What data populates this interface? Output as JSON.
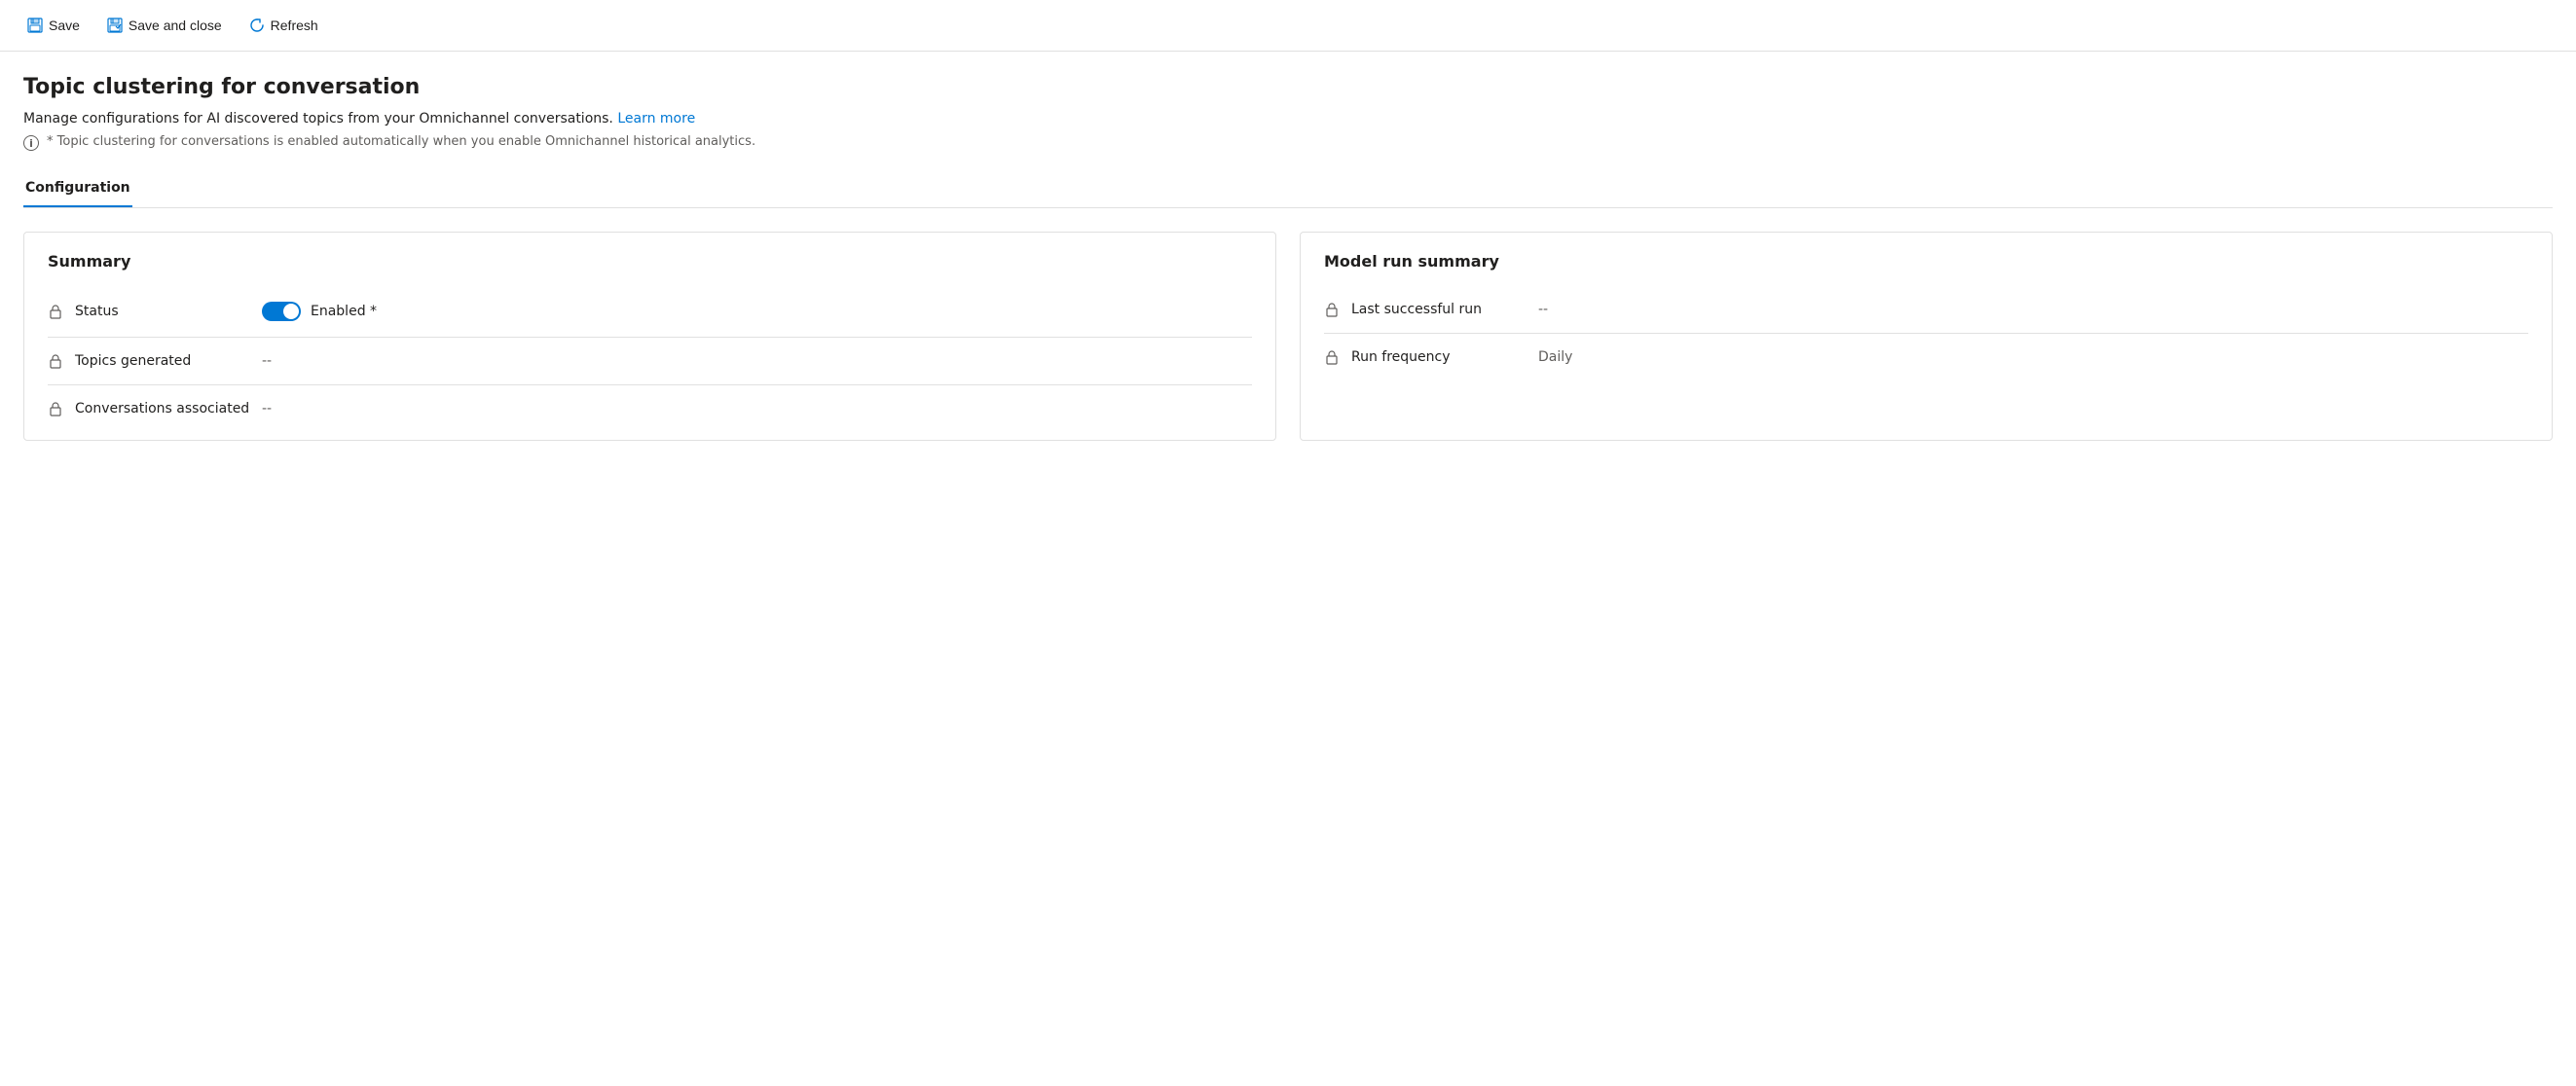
{
  "toolbar": {
    "save_label": "Save",
    "save_close_label": "Save and close",
    "refresh_label": "Refresh"
  },
  "page": {
    "title": "Topic clustering for conversation",
    "description": "Manage configurations for AI discovered topics from your Omnichannel conversations.",
    "learn_more_label": "Learn more",
    "info_note": "* Topic clustering for conversations is enabled automatically when you enable Omnichannel historical analytics.",
    "info_icon": "i"
  },
  "tabs": [
    {
      "label": "Configuration",
      "active": true
    }
  ],
  "summary_card": {
    "title": "Summary",
    "rows": [
      {
        "field": "Status",
        "toggle": true,
        "toggle_state": "enabled",
        "value": "Enabled *"
      },
      {
        "field": "Topics generated",
        "value": "--"
      },
      {
        "field": "Conversations associated",
        "value": "--"
      }
    ]
  },
  "model_run_card": {
    "title": "Model run summary",
    "rows": [
      {
        "field": "Last successful run",
        "value": "--"
      },
      {
        "field": "Run frequency",
        "value": "Daily"
      }
    ]
  },
  "icons": {
    "save": "💾",
    "save_close": "💾",
    "refresh": "↻",
    "lock": "🔒",
    "info": "i"
  }
}
